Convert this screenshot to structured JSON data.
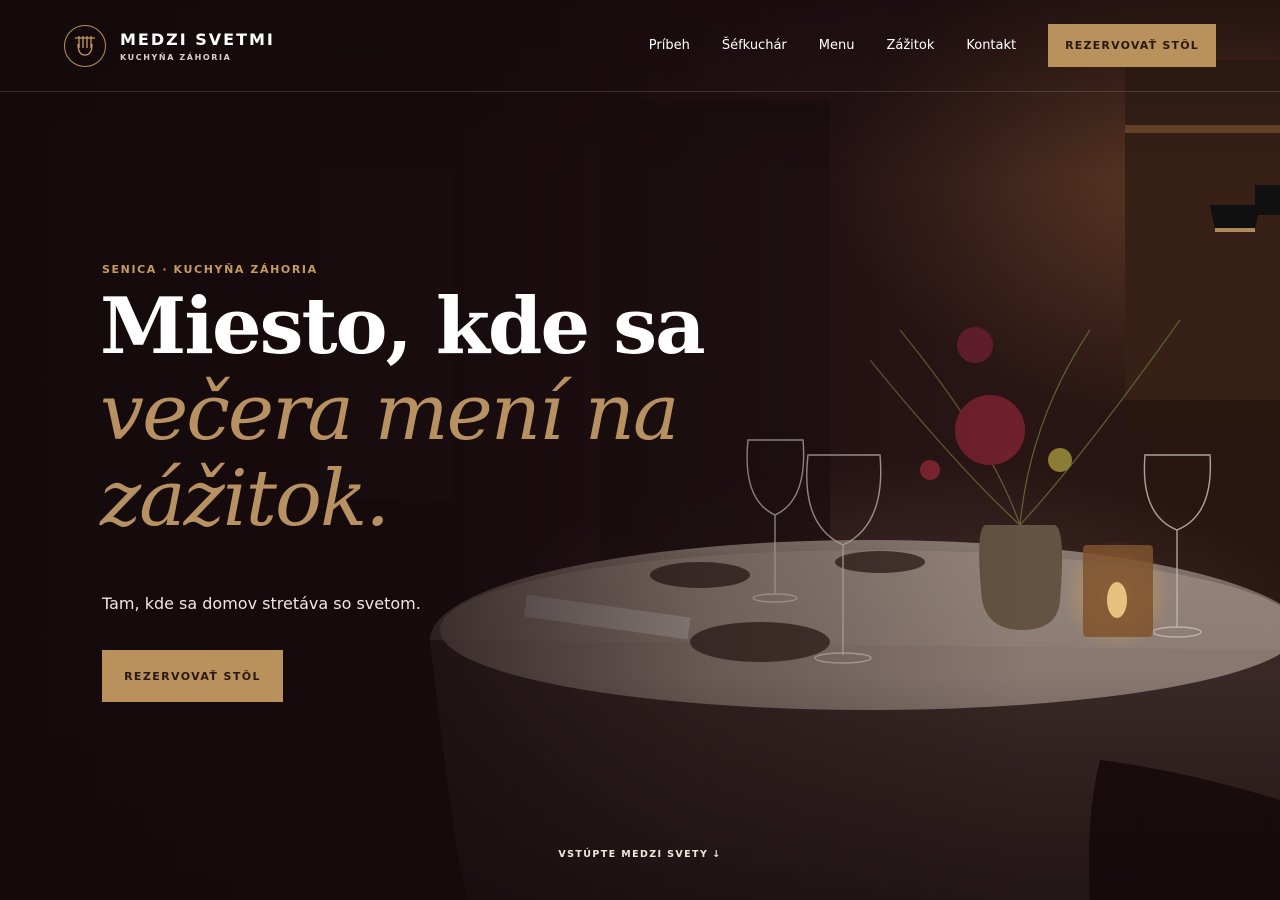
{
  "brand": {
    "name": "MEDZI SVETMI",
    "tagline": "KUCHYŇA ZÁHORIA",
    "logo_icon": "fork-emblem-icon"
  },
  "nav": {
    "items": [
      {
        "label": "Príbeh"
      },
      {
        "label": "Šéfkuchár"
      },
      {
        "label": "Menu"
      },
      {
        "label": "Zážitok"
      },
      {
        "label": "Kontakt"
      }
    ],
    "cta_label": "REZERVOVAŤ STÔL"
  },
  "hero": {
    "eyebrow": "SENICA · KUCHYŇA ZÁHORIA",
    "headline_line1": "Miesto, kde sa",
    "headline_line2": "večera mení na",
    "headline_line3": "zážitok.",
    "subtitle": "Tam, kde sa domov stretáva so svetom.",
    "cta_label": "REZERVOVAŤ STÔL",
    "scroll_label": "VSTÚPTE MEDZI SVETY",
    "scroll_arrow": "↓",
    "background": "dining-table-photo"
  },
  "colors": {
    "accent": "#b8915c",
    "headline_italic": "#b89163",
    "eyebrow": "#c69b62",
    "background": "#1a0d0f",
    "button_text": "#2a1812"
  }
}
